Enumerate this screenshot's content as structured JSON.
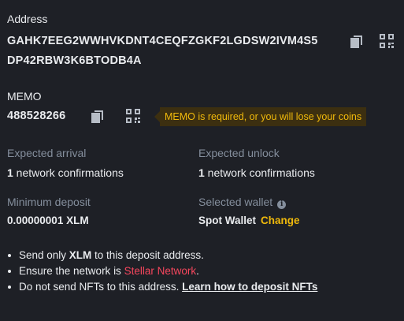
{
  "address": {
    "label": "Address",
    "value_line1": "GAHK7EEG2WWHVKDNT4CEQFZGKF2LGDSW2IVM4S5",
    "value_line2": "DP42RBW3K6BTODB4A",
    "copy_icon": "copy-icon",
    "qr_icon": "qr-code-icon"
  },
  "memo": {
    "label": "MEMO",
    "value": "488528266",
    "copy_icon": "copy-icon",
    "qr_icon": "qr-code-icon",
    "warning": "MEMO is required, or you will lose your coins",
    "warning_color": "#f0b90b"
  },
  "info": {
    "expected_arrival": {
      "label": "Expected arrival",
      "count": "1",
      "unit": " network confirmations"
    },
    "expected_unlock": {
      "label": "Expected unlock",
      "count": "1",
      "unit": " network confirmations"
    },
    "minimum_deposit": {
      "label": "Minimum deposit",
      "value": "0.00000001 XLM"
    },
    "selected_wallet": {
      "label": "Selected wallet",
      "info_icon": "info-icon",
      "value": "Spot Wallet",
      "change_label": "Change"
    }
  },
  "notes": {
    "note1_prefix": "Send only ",
    "note1_coin": "XLM",
    "note1_suffix": " to this deposit address.",
    "note2_prefix": "Ensure the network is ",
    "note2_network": "Stellar Network",
    "note2_suffix": ".",
    "note3_prefix": "Do not send NFTs to this address. ",
    "note3_link": "Learn how to deposit NFTs"
  },
  "colors": {
    "background": "#1e2026",
    "text": "#eaecef",
    "muted": "#848e9c",
    "accent": "#f0b90b",
    "network_red": "#f6465d"
  }
}
